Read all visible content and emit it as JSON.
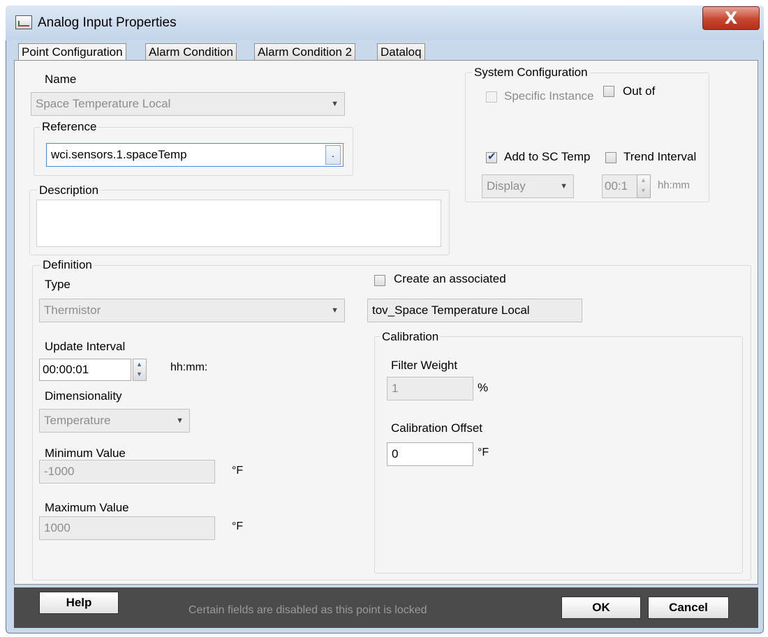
{
  "window": {
    "title": "Analog Input Properties",
    "close_glyph": "X"
  },
  "tabs": [
    "Point Configuration",
    "Alarm Condition",
    "Alarm Condition 2",
    "Dataloq"
  ],
  "name": {
    "label": "Name",
    "value": "Space Temperature Local"
  },
  "reference": {
    "label": "Reference",
    "value": "wci.sensors.1.spaceTemp",
    "browse_label": "."
  },
  "description": {
    "label": "Description",
    "value": ""
  },
  "system_config": {
    "label": "System Configuration",
    "specific_instance": {
      "label": "Specific Instance",
      "checked": false
    },
    "out_of": {
      "label": "Out of",
      "checked": false
    },
    "add_to_sc": {
      "label": "Add to SC Temp",
      "checked": true
    },
    "trend_interval": {
      "label": "Trend Interval",
      "checked": false
    },
    "display_value": "Display",
    "interval_value": "00:1",
    "interval_unit": "hh:mm"
  },
  "definition": {
    "label": "Definition",
    "type": {
      "label": "Type",
      "value": "Thermistor"
    },
    "update_interval": {
      "label": "Update Interval",
      "value": "00:00:01",
      "unit": "hh:mm:"
    },
    "dimensionality": {
      "label": "Dimensionality",
      "value": "Temperature"
    },
    "min_value": {
      "label": "Minimum Value",
      "value": "-1000",
      "unit": "°F"
    },
    "max_value": {
      "label": "Maximum Value",
      "value": "1000",
      "unit": "°F"
    }
  },
  "associated": {
    "label": "Create an associated",
    "checked": false,
    "value": "tov_Space Temperature Local"
  },
  "calibration": {
    "label": "Calibration",
    "filter_weight": {
      "label": "Filter Weight",
      "value": "1",
      "unit": "%"
    },
    "offset": {
      "label": "Calibration Offset",
      "value": "0",
      "unit": "°F"
    }
  },
  "footer": {
    "help": "Help",
    "status": "Certain fields are disabled as this point is locked",
    "ok": "OK",
    "cancel": "Cancel"
  }
}
